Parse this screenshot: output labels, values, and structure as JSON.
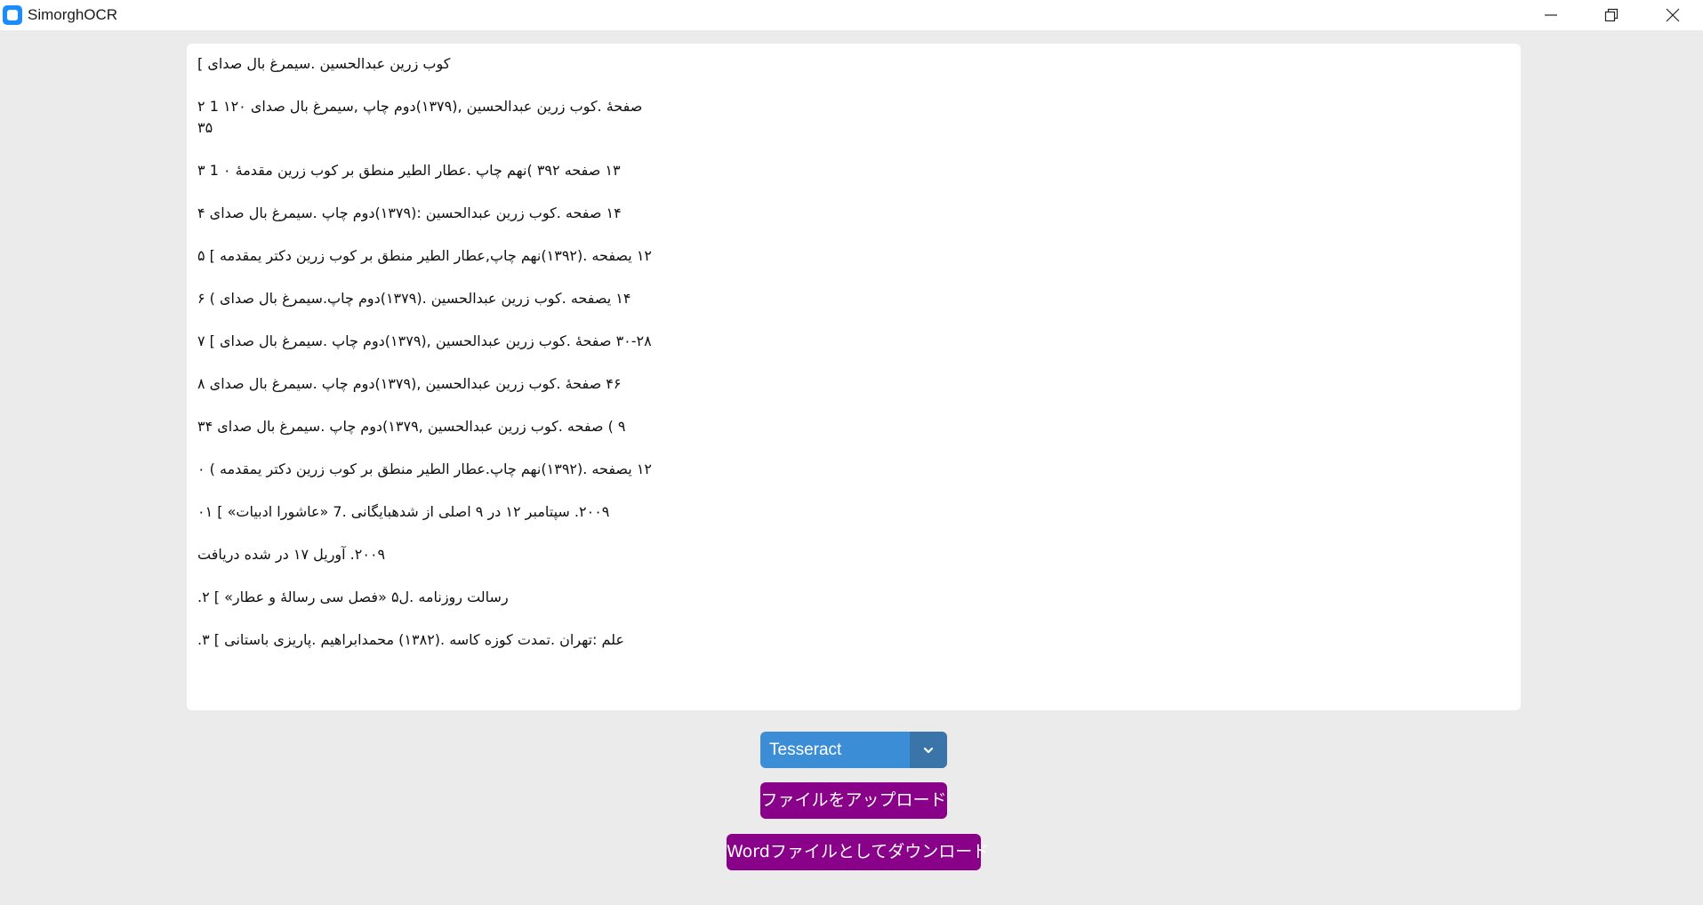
{
  "window": {
    "title": "SimorghOCR"
  },
  "ocr_text": {
    "lines": [
      "کوب زرین عبدالحسین .سیمرغ بال صدای ]",
      "صفحهٔ .کوب زرین عبدالحسین ,(۱۳۷۹)دوم چاپ ,سیمرغ بال صدای ۱۲۰ 1 ۲\n۳۵",
      "۱۳ صفحه ۳۹۲ )نهم چاپ .عطار الطیر منطق بر کوب زرین مقدمهٔ ۰ 1 ۳",
      "۱۴ صفحه .کوب زرین عبدالحسین :(۱۳۷۹)دوم چاپ .سیمرغ بال صدای ۴",
      "۱۲ یصفحه .(۱۳۹۲)نهم چاپ,عطار الطیر منطق بر کوب زرین دکتر یمقدمه ] ۵",
      "۱۴ یصفحه .کوب زرین عبدالحسین .(۱۳۷۹)دوم چاپ.سیمرغ بال صدای ) ۶",
      "۳۰-۲۸ صفحهٔ .کوب زرین عبدالحسین ,(۱۳۷۹)دوم چاپ .سیمرغ بال صدای ] ۷",
      "۴۶ صفحهٔ .کوب زرین عبدالحسین ,(۱۳۷۹)دوم چاپ .سیمرغ بال صدای ۸",
      "۹ ) صفحه .کوب زرین عبدالحسین ,۱۳۷۹)دوم چاپ .سیمرغ بال صدای ۳۴",
      "۱۲ یصفحه .(۱۳۹۲)نهم چاپ.عطار الطیر منطق بر کوب زرین دکتر یمقدمه ) ۰",
      "۲۰۰۹. سپتامبر ۱۲ در ۹ اصلی از شدهبایگانی .7 «عاشورا ادبیات» ] ۰۱",
      "۲۰۰۹. آوریل ۱۷ در شده دریافت",
      "رسالت روزنامه .ل۵ «فصل سی رسالهٔ و عطار» ] ۲.",
      "علم :تهران .تمدت کوزه کاسه .(۱۳۸۲) محمدابراهیم .پاریزی باستانی ] ۳."
    ]
  },
  "controls": {
    "engine_select": {
      "value": "Tesseract",
      "icon": "chevron-down-icon"
    },
    "upload_label": "ファイルをアップロード",
    "download_label": "Wordファイルとしてダウンロード"
  },
  "colors": {
    "background": "#ebebeb",
    "select_blue": "#3b8ed6",
    "select_arrow_blue": "#3a74a8",
    "button_purple": "#890089"
  }
}
